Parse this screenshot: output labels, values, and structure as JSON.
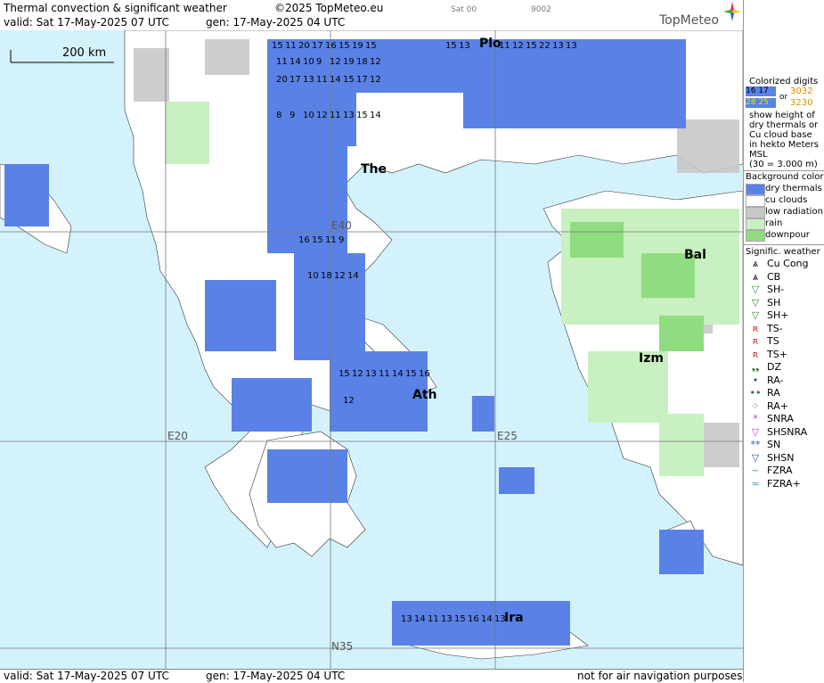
{
  "header": {
    "title": "Thermal convection & significant weather",
    "copyright": "©2025 TopMeteo.eu",
    "sat": "Sat 00",
    "code": "9002",
    "valid": "valid:  Sat  17-May-2025  07 UTC",
    "gen": "gen: 17-May-2025 04 UTC",
    "brand": "TopMeteo"
  },
  "scale": {
    "label": "200 km"
  },
  "cities": [
    {
      "name": "Plo"
    },
    {
      "name": "The"
    },
    {
      "name": "Bal"
    },
    {
      "name": "Izm"
    },
    {
      "name": "Ath"
    },
    {
      "name": "Ira"
    }
  ],
  "grid_labels": [
    "E40",
    "E20",
    "E25",
    "N35"
  ],
  "footer": {
    "valid": "valid:  Sat  17-May-2025  07 UTC",
    "gen": "gen: 17-May-2025 04 UTC",
    "note": "not for air navigation purposes"
  },
  "legend": {
    "digits_title": "Colorized digits",
    "digits_sample_1": "16 17",
    "digits_or": "or",
    "digits_sample_2": "3032",
    "digits_sample_3": "28 25",
    "digits_sample_4": "3230",
    "desc": [
      "show height of",
      "dry thermals or",
      "Cu cloud base",
      "in hekto Meters",
      "MSL",
      "(30 = 3.000 m)"
    ],
    "bg_title": "Background color",
    "bg": [
      {
        "label": "dry thermals",
        "color": "#5a82e6"
      },
      {
        "label": "cu clouds",
        "color": "#ffffff"
      },
      {
        "label": "low radiation",
        "color": "#c8c8c8"
      },
      {
        "label": "rain",
        "color": "#c8f0c0"
      },
      {
        "label": "downpour",
        "color": "#90dc80"
      }
    ],
    "wx_title": "Signific. weather",
    "wx": [
      {
        "sym": "⩓",
        "label": "Cu Cong"
      },
      {
        "sym": "⩓",
        "label": "CB"
      },
      {
        "sym": "▽",
        "label": "SH-"
      },
      {
        "sym": "▽",
        "label": "SH"
      },
      {
        "sym": "▽",
        "label": "SH+"
      },
      {
        "sym": "ʀ",
        "label": "TS-"
      },
      {
        "sym": "ʀ",
        "label": "TS"
      },
      {
        "sym": "ʀ",
        "label": "TS+"
      },
      {
        "sym": "❟❟",
        "label": "DZ"
      },
      {
        "sym": "•",
        "label": "RA-"
      },
      {
        "sym": "••",
        "label": "RA"
      },
      {
        "sym": "⁘",
        "label": "RA+"
      },
      {
        "sym": "*",
        "label": "SNRA"
      },
      {
        "sym": "▽",
        "label": "SHSNRA"
      },
      {
        "sym": "**",
        "label": "SN"
      },
      {
        "sym": "▽",
        "label": "SHSN"
      },
      {
        "sym": "~",
        "label": "FZRA"
      },
      {
        "sym": "≈",
        "label": "FZRA+"
      }
    ]
  },
  "colors": {
    "sea": "#d4f2fb",
    "land": "#ffffff",
    "dry": "#5a82e6",
    "low_rad": "#c8c8c8",
    "rain": "#c8f0c0",
    "downpour": "#90dc80"
  },
  "map_cells": [
    {
      "text": "15"
    },
    {
      "text": "11"
    },
    {
      "text": "20"
    },
    {
      "text": "17"
    },
    {
      "text": "16"
    },
    {
      "text": "15"
    },
    {
      "text": "19"
    },
    {
      "text": "15"
    },
    {
      "text": "15"
    },
    {
      "text": "13"
    },
    {
      "text": "11"
    },
    {
      "text": "12"
    },
    {
      "text": "15"
    },
    {
      "text": "22"
    },
    {
      "text": "13"
    },
    {
      "text": "13"
    },
    {
      "text": "11"
    },
    {
      "text": "14"
    },
    {
      "text": "10"
    },
    {
      "text": "9"
    },
    {
      "text": "12"
    },
    {
      "text": "19"
    },
    {
      "text": "18"
    },
    {
      "text": "12"
    },
    {
      "text": "20"
    },
    {
      "text": "17"
    },
    {
      "text": "13"
    },
    {
      "text": "11"
    },
    {
      "text": "14"
    },
    {
      "text": "15"
    },
    {
      "text": "17"
    },
    {
      "text": "12"
    },
    {
      "text": "8"
    },
    {
      "text": "9"
    },
    {
      "text": "10"
    },
    {
      "text": "12"
    },
    {
      "text": "11"
    },
    {
      "text": "13"
    },
    {
      "text": "15"
    },
    {
      "text": "14"
    },
    {
      "text": "16"
    },
    {
      "text": "15"
    },
    {
      "text": "11"
    },
    {
      "text": "9"
    },
    {
      "text": "10"
    },
    {
      "text": "18"
    },
    {
      "text": "12"
    },
    {
      "text": "14"
    },
    {
      "text": "15"
    },
    {
      "text": "12"
    },
    {
      "text": "13"
    },
    {
      "text": "11"
    },
    {
      "text": "14"
    },
    {
      "text": "15"
    },
    {
      "text": "16"
    },
    {
      "text": "12"
    },
    {
      "text": "13"
    },
    {
      "text": "14"
    },
    {
      "text": "11"
    },
    {
      "text": "13"
    },
    {
      "text": "15"
    },
    {
      "text": "16"
    },
    {
      "text": "14"
    },
    {
      "text": "13"
    }
  ]
}
